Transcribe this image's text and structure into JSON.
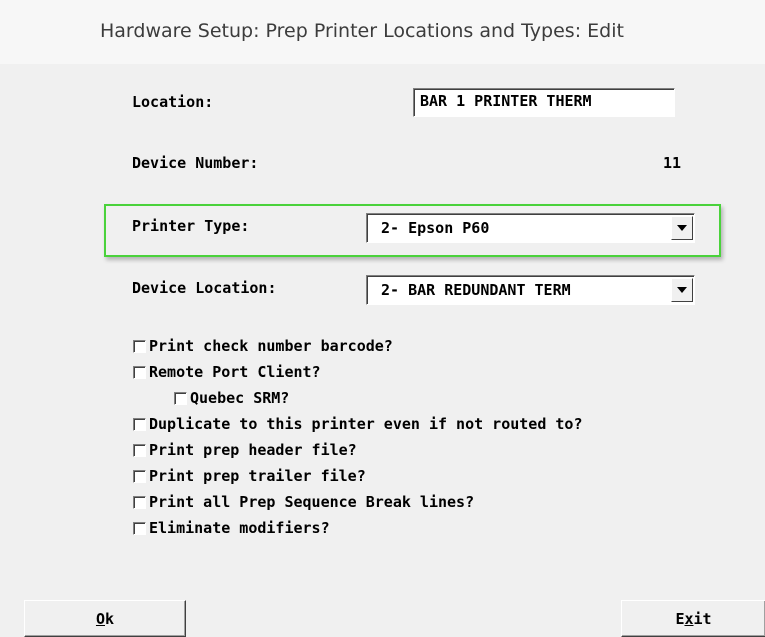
{
  "window": {
    "title": "Hardware Setup:  Prep Printer Locations and Types:  Edit"
  },
  "form": {
    "location_label": "Location:",
    "location_value": "BAR 1 PRINTER THERM",
    "device_number_label": "Device Number:",
    "device_number_value": "11",
    "printer_type_label": "Printer Type:",
    "printer_type_value": "2- Epson P60",
    "device_location_label": "Device Location:",
    "device_location_value": "2- BAR REDUNDANT TERM",
    "highlight_color": "#4ad23b"
  },
  "checkboxes": [
    {
      "label": "Print check number barcode?",
      "checked": false
    },
    {
      "label": "Remote Port Client?",
      "checked": false
    },
    {
      "label": "Quebec SRM?",
      "checked": false
    },
    {
      "label": "Duplicate to this printer even if not routed to?",
      "checked": false
    },
    {
      "label": "Print prep header file?",
      "checked": false
    },
    {
      "label": "Print prep trailer file?",
      "checked": false
    },
    {
      "label": "Print all Prep Sequence Break lines?",
      "checked": false
    },
    {
      "label": "Eliminate modifiers?",
      "checked": false
    }
  ],
  "buttons": {
    "ok_mnemonic": "O",
    "ok_rest": "k",
    "exit_first": "E",
    "exit_mnemonic": "x",
    "exit_rest": "it"
  }
}
